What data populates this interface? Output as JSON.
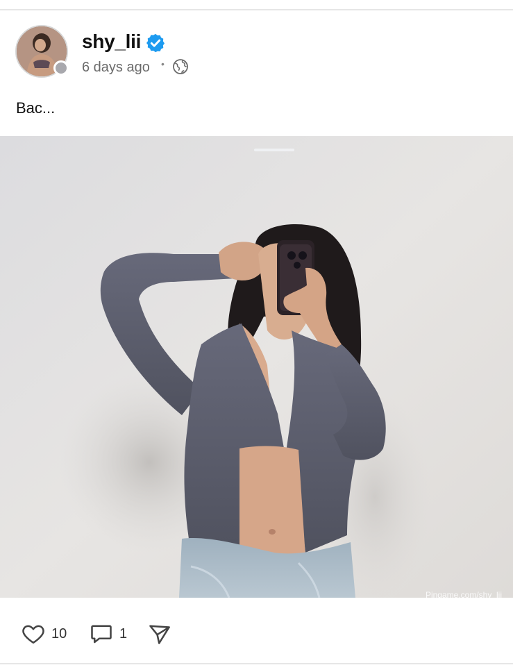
{
  "post": {
    "author": {
      "username": "shy_lii",
      "verified": true,
      "presence": "offline"
    },
    "timestamp": "6 days ago",
    "separator": "•",
    "visibility_icon": "globe-icon",
    "text": "Bac...",
    "image": {
      "watermark": "Pingame.com/shy_lii"
    },
    "actions": {
      "like_icon": "heart-icon",
      "like_count": "10",
      "comment_icon": "comment-icon",
      "comment_count": "1",
      "share_icon": "send-icon"
    }
  },
  "colors": {
    "verified_badge": "#1d9bf0",
    "timestamp_text": "#6b6b6b",
    "divider": "#e6e6e6",
    "presence_dot": "#a8a8ad"
  }
}
